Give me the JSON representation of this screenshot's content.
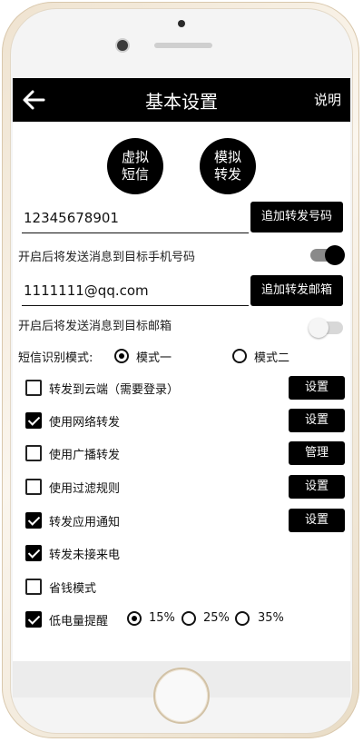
{
  "header": {
    "title": "基本设置",
    "help_label": "说明",
    "back_icon": "arrow-left-icon"
  },
  "actions": {
    "virtual_sms": "虚拟\n短信",
    "simulate_forward": "模拟\n转发"
  },
  "phone": {
    "value": "12345678901",
    "add_button": "追加转发号码",
    "caption": "开启后将发送消息到目标手机号码",
    "enabled": true
  },
  "email": {
    "value": "1111111@qq.com",
    "add_button": "追加转发邮箱",
    "caption": "开启后将发送消息到目标邮箱",
    "enabled": false
  },
  "sms_mode": {
    "label": "短信识别模式:",
    "options": [
      "模式一",
      "模式二"
    ],
    "selected": "模式一"
  },
  "options": [
    {
      "label": "转发到云端（需要登录）",
      "checked": false,
      "button": "设置"
    },
    {
      "label": "使用网络转发",
      "checked": true,
      "button": "设置"
    },
    {
      "label": "使用广播转发",
      "checked": false,
      "button": "管理"
    },
    {
      "label": "使用过滤规则",
      "checked": false,
      "button": "设置"
    },
    {
      "label": "转发应用通知",
      "checked": true,
      "button": "设置"
    },
    {
      "label": "转发未接来电",
      "checked": true
    },
    {
      "label": "省钱模式",
      "checked": false
    },
    {
      "label": "低电量提醒",
      "checked": true
    }
  ],
  "battery": {
    "levels": [
      "15%",
      "25%",
      "35%"
    ],
    "selected": "15%"
  },
  "colors": {
    "bar": "#000000",
    "accent": "#000000",
    "frame": "#efe3d0"
  }
}
